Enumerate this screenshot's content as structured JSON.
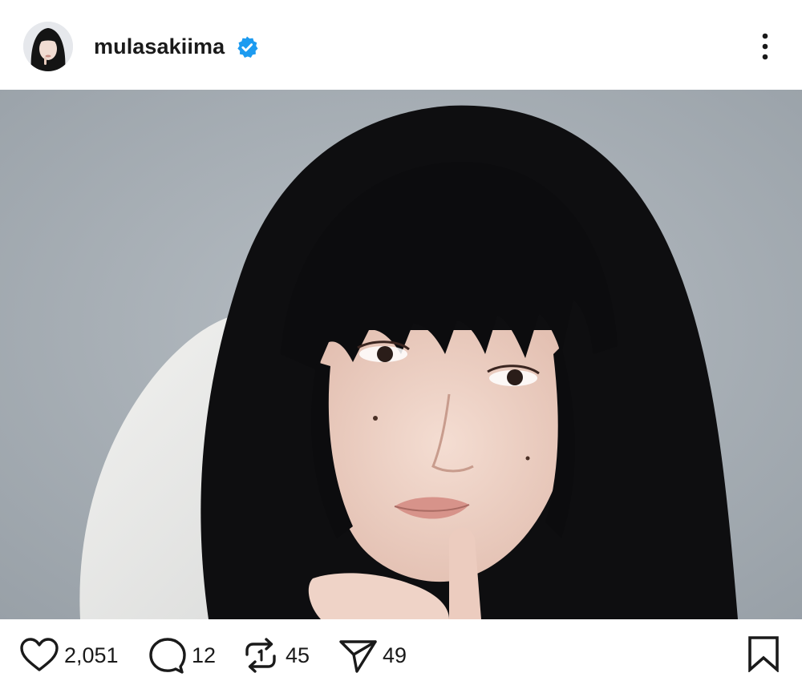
{
  "header": {
    "username": "mulasakiima",
    "verified": true,
    "avatar_icon": "profile-photo-avatar",
    "more_icon": "more-vertical-icon"
  },
  "post": {
    "image_alt_icon": "portrait-photo"
  },
  "actions": {
    "likes": "2,051",
    "comments": "12",
    "reposts": "45",
    "shares": "49",
    "like_icon": "heart-icon",
    "comment_icon": "comment-bubble-icon",
    "repost_icon": "repost-icon",
    "share_icon": "send-icon",
    "bookmark_icon": "bookmark-icon"
  },
  "colors": {
    "verified_badge": "#1d9bf0",
    "text": "#1a1a1a",
    "background": "#ffffff",
    "photo_backdrop": "#a9b0b6"
  }
}
